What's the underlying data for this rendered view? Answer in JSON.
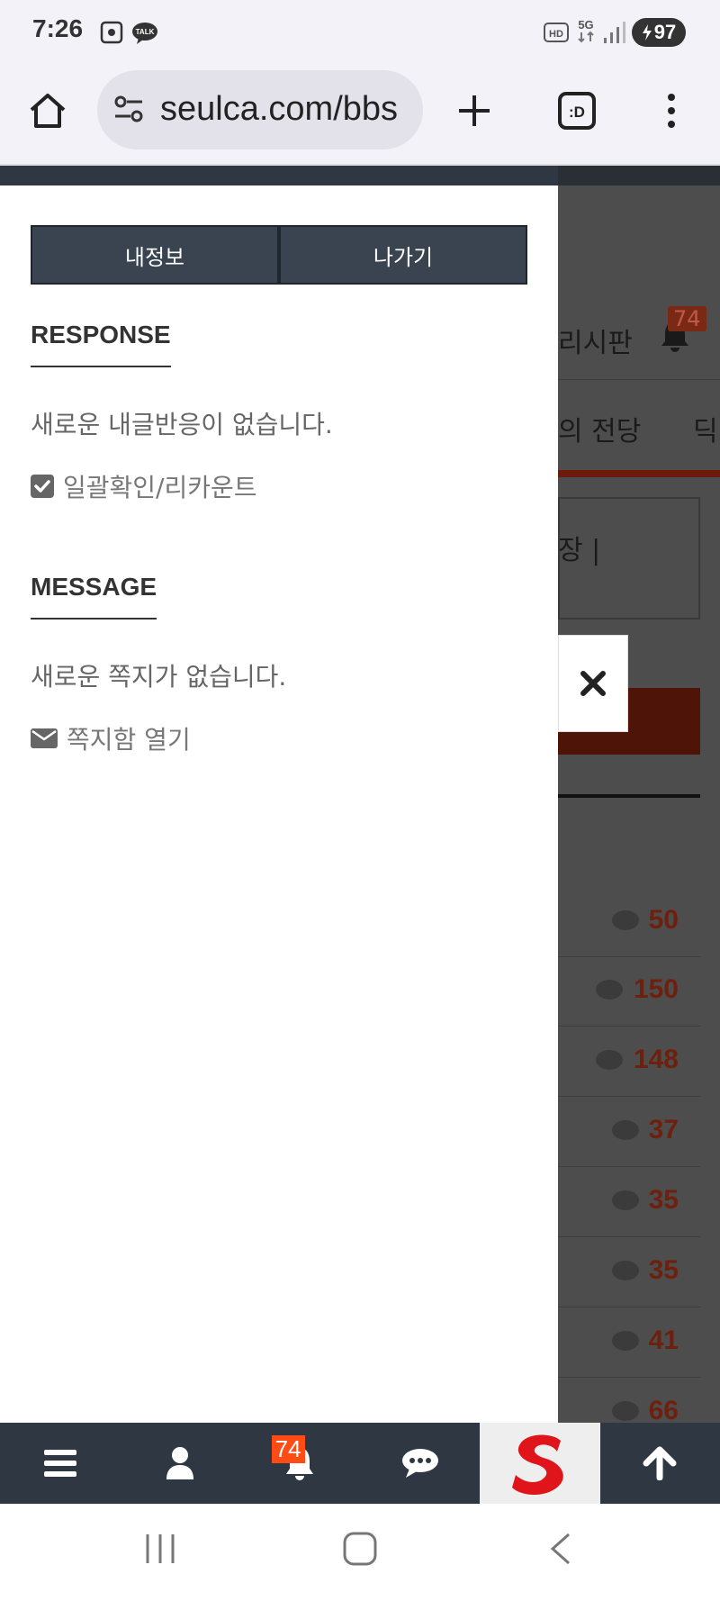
{
  "status_bar": {
    "time": "7:26",
    "talk_label": "TALK",
    "hd_label": "HD",
    "network_label": "5G",
    "battery": "97"
  },
  "browser": {
    "url": "seulca.com/bbs",
    "tab_icon_label": ":D"
  },
  "panel": {
    "buttons": {
      "my_info": "내정보",
      "logout": "나가기"
    },
    "response": {
      "title": "RESPONSE",
      "empty_text": "새로운 내글반응이 없습니다.",
      "bulk_check_label": "일괄확인/리카운트"
    },
    "message": {
      "title": "MESSAGE",
      "empty_text": "새로운 쪽지가 없습니다.",
      "open_inbox_label": "쪽지함 열기"
    }
  },
  "background_page": {
    "nav_partial": "리시판",
    "notification_count": "74",
    "tab_partial": "의 전당",
    "tab_partial_2": "딕",
    "box_partial": "장 |",
    "comment_counts": [
      "50",
      "150",
      "148",
      "37",
      "35",
      "35",
      "41",
      "66"
    ]
  },
  "bottom_nav": {
    "notification_badge": "74",
    "items": [
      "menu-icon",
      "user-icon",
      "bell-icon",
      "chat-icon",
      "site-logo",
      "arrow-up-icon"
    ]
  },
  "colors": {
    "panel_dark": "#2e3742",
    "button_dark": "#3a4451",
    "badge_orange": "#ff4b14",
    "count_red": "#6e200e"
  }
}
